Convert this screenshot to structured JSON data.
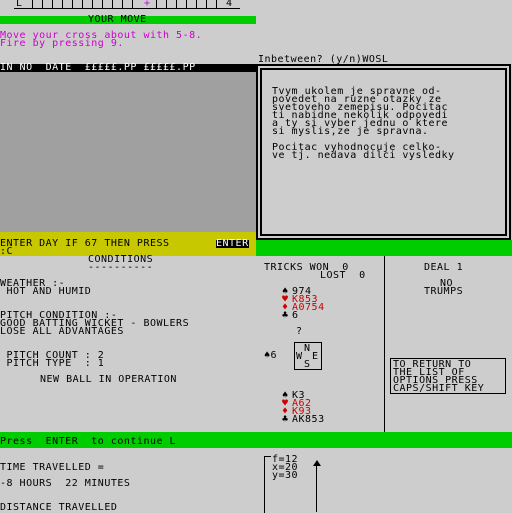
{
  "top_ruler": {
    "left_mark": "L",
    "mid_mark": "+",
    "right_mark": "4"
  },
  "your_move_bar": "YOUR MOVE",
  "move_instructions": [
    "Move your cross about with 5-8.",
    "Fire by pressing 9."
  ],
  "table_header": "IN NO  DATE  £££££.PP £££££.PP",
  "inbetween_prompt": "Inbetween? (y/n)WOSL",
  "czech_text": [
    "Tvym ukolem je spravne od-",
    "povedet na ruzne otazky ze",
    "svetoveho zemepisu. Pocitac",
    "ti nabidne nekolik odpovedi",
    "a ty si vyber jednu o ktere",
    "si myslis,ze je spravna.",
    "",
    "Pocitac vyhodnocuje celko-",
    "ve tj. nedava dilci vysledky"
  ],
  "enter_day_prompt": {
    "text": "ENTER DAY IF 67 THEN PRESS ",
    "key": "ENTER",
    "input": ":C"
  },
  "conditions": {
    "title": "CONDITIONS",
    "underline": "----------",
    "weather_label": "WEATHER :-",
    "weather_value": " HOT AND HUMID",
    "pitch_label": "PITCH CONDITION :-",
    "pitch_value_1": "GOOD BATTING WICKET - BOWLERS",
    "pitch_value_2": "LOSE ALL ADVANTAGES",
    "pitch_count": " PITCH COUNT : 2",
    "pitch_type": " PITCH TYPE  : 1",
    "new_ball": "NEW BALL IN OPERATION"
  },
  "bridge": {
    "tricks_won": "TRICKS WON  0",
    "tricks_lost": "LOST  0",
    "deal": "DEAL 1",
    "trumps_1": "NO",
    "trumps_2": "TRUMPS",
    "north": [
      {
        "suit": "♠",
        "cards": "974",
        "color": "#000000"
      },
      {
        "suit": "♥",
        "cards": "K853",
        "color": "#cd0000"
      },
      {
        "suit": "♦",
        "cards": "A0754",
        "color": "#cd0000"
      },
      {
        "suit": "♣",
        "cards": "6",
        "color": "#000000"
      }
    ],
    "question": "?",
    "west_bid": "♠6",
    "compass": {
      "n": "N",
      "w": "W",
      "e": "E",
      "s": "S"
    },
    "south": [
      {
        "suit": "♠",
        "cards": "K3",
        "color": "#000000"
      },
      {
        "suit": "♥",
        "cards": "A62",
        "color": "#cd0000"
      },
      {
        "suit": "♦",
        "cards": "K93",
        "color": "#cd0000"
      },
      {
        "suit": "♣",
        "cards": "AK853",
        "color": "#000000"
      }
    ],
    "options_box": [
      "TO RETURN TO",
      "THE LIST OF",
      "OPTIONS PRESS",
      "CAPS/SHIFT KEY"
    ]
  },
  "continue_bar": "Press  ENTER  to continue L",
  "travel": {
    "time_label": "TIME TRAVELLED =",
    "time_value": "-8 HOURS  22 MINUTES",
    "distance_label": "DISTANCE TRAVELLED",
    "f": "f=12",
    "x": "x=20",
    "y": "y=30"
  }
}
